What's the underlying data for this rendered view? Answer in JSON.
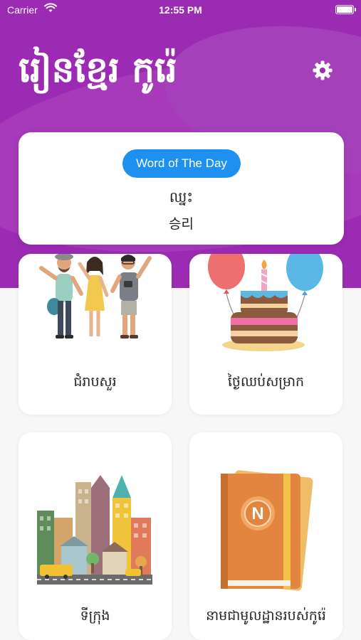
{
  "status_bar": {
    "carrier": "Carrier",
    "time": "12:55 PM"
  },
  "header": {
    "title": "រៀនខ្មែរ កូរ៉េ",
    "background_color": "#9b2bb3",
    "settings_icon": "gear-icon"
  },
  "word_of_day": {
    "badge_label": "Word of The Day",
    "badge_color": "#1e90f0",
    "word": "ឈ្នះ",
    "translation": "승리"
  },
  "categories": [
    {
      "label": "ជំរាបសួរ",
      "icon": "greeting-people-illustration"
    },
    {
      "label": "ថ្ងៃឈប់សម្រាក",
      "icon": "birthday-cake-illustration"
    },
    {
      "label": "ទីក្រុង",
      "icon": "city-buildings-illustration"
    },
    {
      "label": "នាមជាមូលដ្ឋានរបស់កូរ៉េ",
      "icon": "notebook-illustration"
    }
  ]
}
